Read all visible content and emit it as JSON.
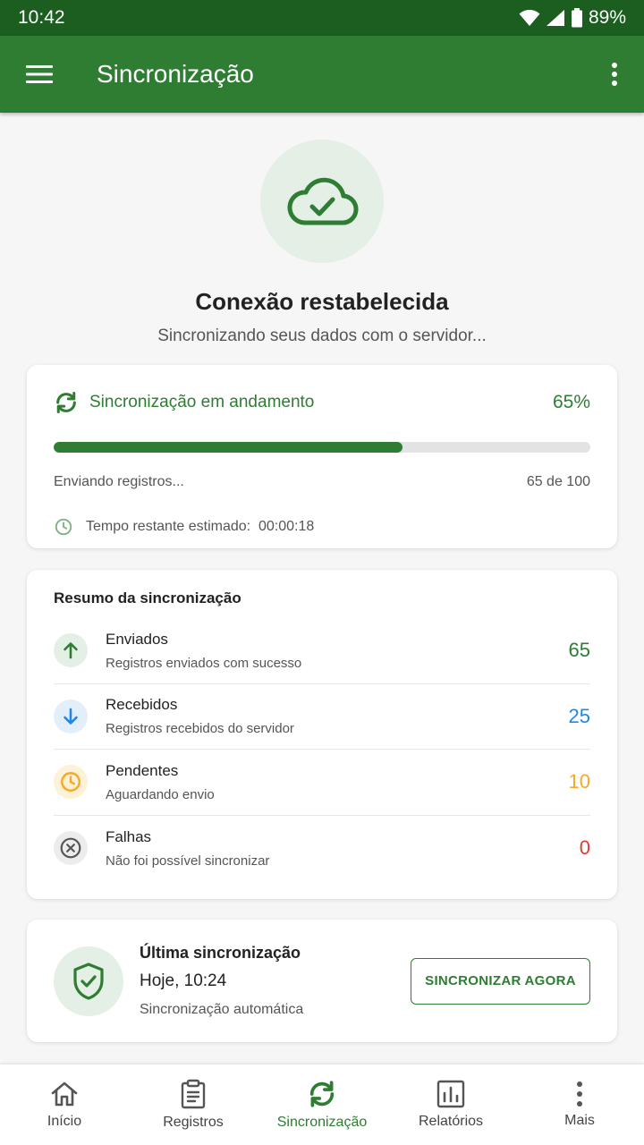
{
  "status_bar": {
    "time": "10:42",
    "battery": "89%"
  },
  "app_bar": {
    "title": "Sincronização"
  },
  "hero": {
    "title": "Conexão restabelecida",
    "subtitle": "Sincronizando seus dados com o servidor..."
  },
  "progress": {
    "title": "Sincronização em andamento",
    "percent_label": "65%",
    "fraction": 0.65,
    "stage": "Enviando registros...",
    "count": "65 de 100",
    "eta_label": "Tempo restante estimado:",
    "eta_value": "00:00:18"
  },
  "summary": {
    "title": "Resumo da sincronização",
    "items": [
      {
        "label": "Enviados",
        "desc": "Registros enviados com sucesso",
        "value": "65",
        "color": "#2e7d32",
        "bg": "#e4efe5",
        "icon": "arrow-up-icon"
      },
      {
        "label": "Recebidos",
        "desc": "Registros recebidos do servidor",
        "value": "25",
        "color": "#1e88e5",
        "bg": "#e3eefb",
        "icon": "arrow-down-icon"
      },
      {
        "label": "Pendentes",
        "desc": "Aguardando envio",
        "value": "10",
        "color": "#f9a825",
        "bg": "#fdf1d6",
        "icon": "clock-icon"
      },
      {
        "label": "Falhas",
        "desc": "Não foi possível sincronizar",
        "value": "0",
        "color": "#e53935",
        "bg": "#ececec",
        "icon": "x-circle-icon"
      }
    ]
  },
  "last_sync": {
    "title": "Última sincronização",
    "time": "Hoje, 10:24",
    "mode": "Sincronização automática",
    "button_label": "SINCRONIZAR AGORA"
  },
  "bottom_nav": {
    "items": [
      {
        "label": "Início",
        "icon": "home-icon"
      },
      {
        "label": "Registros",
        "icon": "clipboard-icon"
      },
      {
        "label": "Sincronização",
        "icon": "sync-icon",
        "active": true
      },
      {
        "label": "Relatórios",
        "icon": "bar-chart-icon"
      },
      {
        "label": "Mais",
        "icon": "more-vertical-icon"
      }
    ]
  },
  "colors": {
    "primary": "#2e7d32",
    "primary_dark": "#1b5e20",
    "background": "#f6f6f6"
  }
}
